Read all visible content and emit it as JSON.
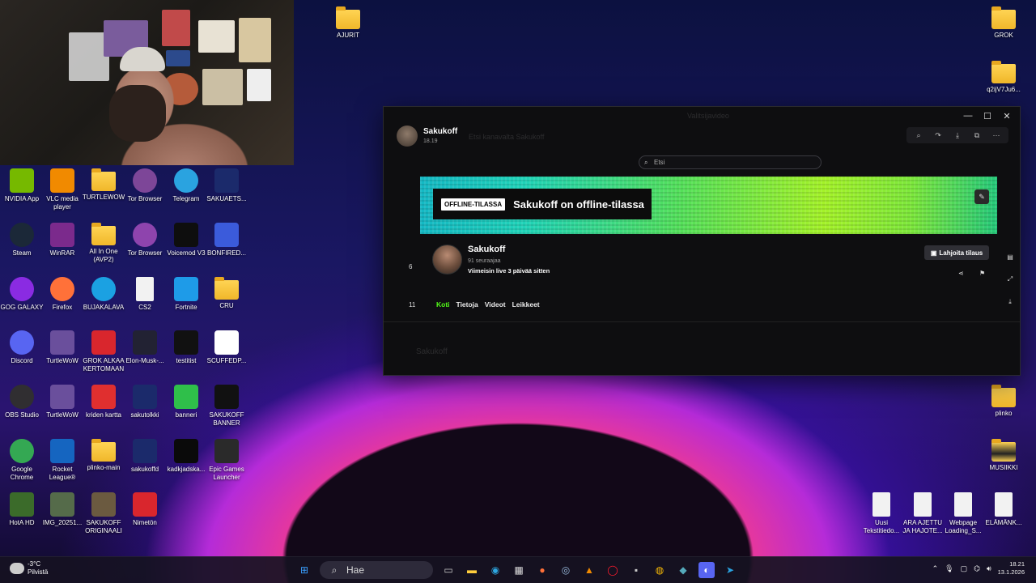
{
  "desktop_icons_left": [
    {
      "label": "NVIDIA App",
      "icon": "nvidia-icon",
      "color": "#76b900"
    },
    {
      "label": "VLC media player",
      "icon": "vlc-icon",
      "color": "#f18a00"
    },
    {
      "label": "TURTLEWOW",
      "icon": "folder-icon",
      "color": "#ffd454"
    },
    {
      "label": "Tor Browser",
      "icon": "tor-icon",
      "color": "#7d4698"
    },
    {
      "label": "Telegram",
      "icon": "telegram-icon",
      "color": "#2aa3e0"
    },
    {
      "label": "SAKUAETS...",
      "icon": "can-icon",
      "color": "#1b2a6b"
    },
    {
      "label": "Steam",
      "icon": "steam-icon",
      "color": "#1b2838"
    },
    {
      "label": "WinRAR",
      "icon": "winrar-icon",
      "color": "#7b2a8c"
    },
    {
      "label": "All In One (AVP2)",
      "icon": "folder-icon",
      "color": "#ffd454"
    },
    {
      "label": "Tor Browser",
      "icon": "tor-icon",
      "color": "#8e44ad"
    },
    {
      "label": "Voicemod V3",
      "icon": "voicemod-icon",
      "color": "#0e0e0e"
    },
    {
      "label": "BONFIRED...",
      "icon": "bonfire-icon",
      "color": "#3b5bdb"
    },
    {
      "label": "GOG GALAXY",
      "icon": "gog-icon",
      "color": "#8a2be2"
    },
    {
      "label": "Firefox",
      "icon": "firefox-icon",
      "color": "#ff7139"
    },
    {
      "label": "BUJAKALAVA",
      "icon": "edge-icon",
      "color": "#1ba1e2"
    },
    {
      "label": "CS2",
      "icon": "document-icon",
      "color": "#f2f2f2"
    },
    {
      "label": "Fortnite",
      "icon": "fortnite-icon",
      "color": "#1e9be8"
    },
    {
      "label": "CRU",
      "icon": "folder-icon",
      "color": "#ffd454"
    },
    {
      "label": "Discord",
      "icon": "discord-icon",
      "color": "#5865f2"
    },
    {
      "label": "TurtleWoW",
      "icon": "turtlewow-icon",
      "color": "#6a4f9c"
    },
    {
      "label": "GROK ALKAA KERTOMAAN",
      "icon": "grok-icon",
      "color": "#d9262d"
    },
    {
      "label": "Elon-Musk-...",
      "icon": "image-icon",
      "color": "#222233"
    },
    {
      "label": "testitist",
      "icon": "image-icon",
      "color": "#111111"
    },
    {
      "label": "SCUFFEDP...",
      "icon": "paypal-icon",
      "color": "#ffffff"
    },
    {
      "label": "OBS Studio",
      "icon": "obs-icon",
      "color": "#302e31"
    },
    {
      "label": "TurtleWoW",
      "icon": "turtlewow-icon",
      "color": "#6a4f9c"
    },
    {
      "label": "kriden kartta",
      "icon": "pdf-icon",
      "color": "#e02f2f"
    },
    {
      "label": "sakutolkki",
      "icon": "can-icon",
      "color": "#1b2a6b"
    },
    {
      "label": "banneri",
      "icon": "banner-icon",
      "color": "#2fbf4a"
    },
    {
      "label": "SAKUKOFF BANNER",
      "icon": "banner-icon",
      "color": "#111111"
    },
    {
      "label": "Google Chrome",
      "icon": "chrome-icon",
      "color": "#34a853"
    },
    {
      "label": "Rocket League®",
      "icon": "rocket-league-icon",
      "color": "#1565c0"
    },
    {
      "label": "plinko-main",
      "icon": "folder-icon",
      "color": "#ffd454"
    },
    {
      "label": "sakukoffd",
      "icon": "can-icon",
      "color": "#1b2a6b"
    },
    {
      "label": "kadkjadska...",
      "icon": "image-icon",
      "color": "#0a0a0a"
    },
    {
      "label": "Epic Games Launcher",
      "icon": "epic-icon",
      "color": "#2a2a2a"
    },
    {
      "label": "HotA HD",
      "icon": "hota-icon",
      "color": "#3b6b2a"
    },
    {
      "label": "IMG_20251...",
      "icon": "image-icon",
      "color": "#556b4a"
    },
    {
      "label": "SAKUKOFF ORIGINAALI",
      "icon": "image-icon",
      "color": "#6b5a40"
    },
    {
      "label": "Nimetön",
      "icon": "paint-icon",
      "color": "#d9262d"
    }
  ],
  "desktop_icons_other": [
    {
      "label": "AJURIT",
      "icon": "folder-icon"
    },
    {
      "label": "GROK",
      "icon": "folder-icon"
    },
    {
      "label": "q2ijV7Ju6...",
      "icon": "folder-icon"
    },
    {
      "label": "plinko",
      "icon": "folder-icon"
    },
    {
      "label": "MUSIIKKI",
      "icon": "folder-icon"
    },
    {
      "label": "Uusi Tekstitiedo...",
      "icon": "document-icon"
    },
    {
      "label": "ARA AJETTU JA HAJOTE...",
      "icon": "document-icon"
    },
    {
      "label": "Webpage Loading_S...",
      "icon": "document-icon"
    },
    {
      "label": "ELÄMÄNK...",
      "icon": "document-icon"
    }
  ],
  "window": {
    "ghost_title": "Valitsijavideo",
    "ghost_channel": "Sakukoff",
    "ghost_text": "Etsi kanavalta Sakukoff",
    "controls": {
      "minimize": "—",
      "maximize": "☐",
      "close": "✕"
    },
    "topbar": {
      "name": "Sakukoff",
      "time": "18.19"
    },
    "toolbar_icons": [
      "zoom-icon",
      "share-icon",
      "download-icon",
      "popout-icon",
      "more-icon"
    ],
    "toolbar_glyphs": [
      "⌕",
      "↷",
      "⤓",
      "⧉",
      "⋯"
    ],
    "search_placeholder": "Etsi",
    "banner": {
      "badge": "OFFLINE-TILASSA",
      "text": "Sakukoff on offline-tilassa"
    },
    "profile": {
      "name": "Sakukoff",
      "followers": "91 seuraajaa",
      "last_live": "Viimeisin live 3 päivää sitten",
      "gift_button": "Lahjoita tilaus"
    },
    "tabs": [
      "Koti",
      "Tietoja",
      "Videot",
      "Leikkeet"
    ],
    "active_tab": "Koti",
    "left_numbers": [
      "6",
      "11"
    ],
    "accent": "#53fc18"
  },
  "taskbar": {
    "weather_temp": "-3°C",
    "weather_desc": "Pilvistä",
    "search_placeholder": "Hae",
    "apps": [
      "windows-start-icon",
      "task-view-icon",
      "explorer-icon",
      "edge-icon",
      "store-icon",
      "firefox-icon",
      "steam-icon",
      "vlc-icon",
      "opera-icon",
      "terminal-icon",
      "chrome-icon",
      "app-icon",
      "discord-icon",
      "telegram-icon"
    ],
    "clock_time": "18.21",
    "clock_date": "13.1.2026"
  }
}
